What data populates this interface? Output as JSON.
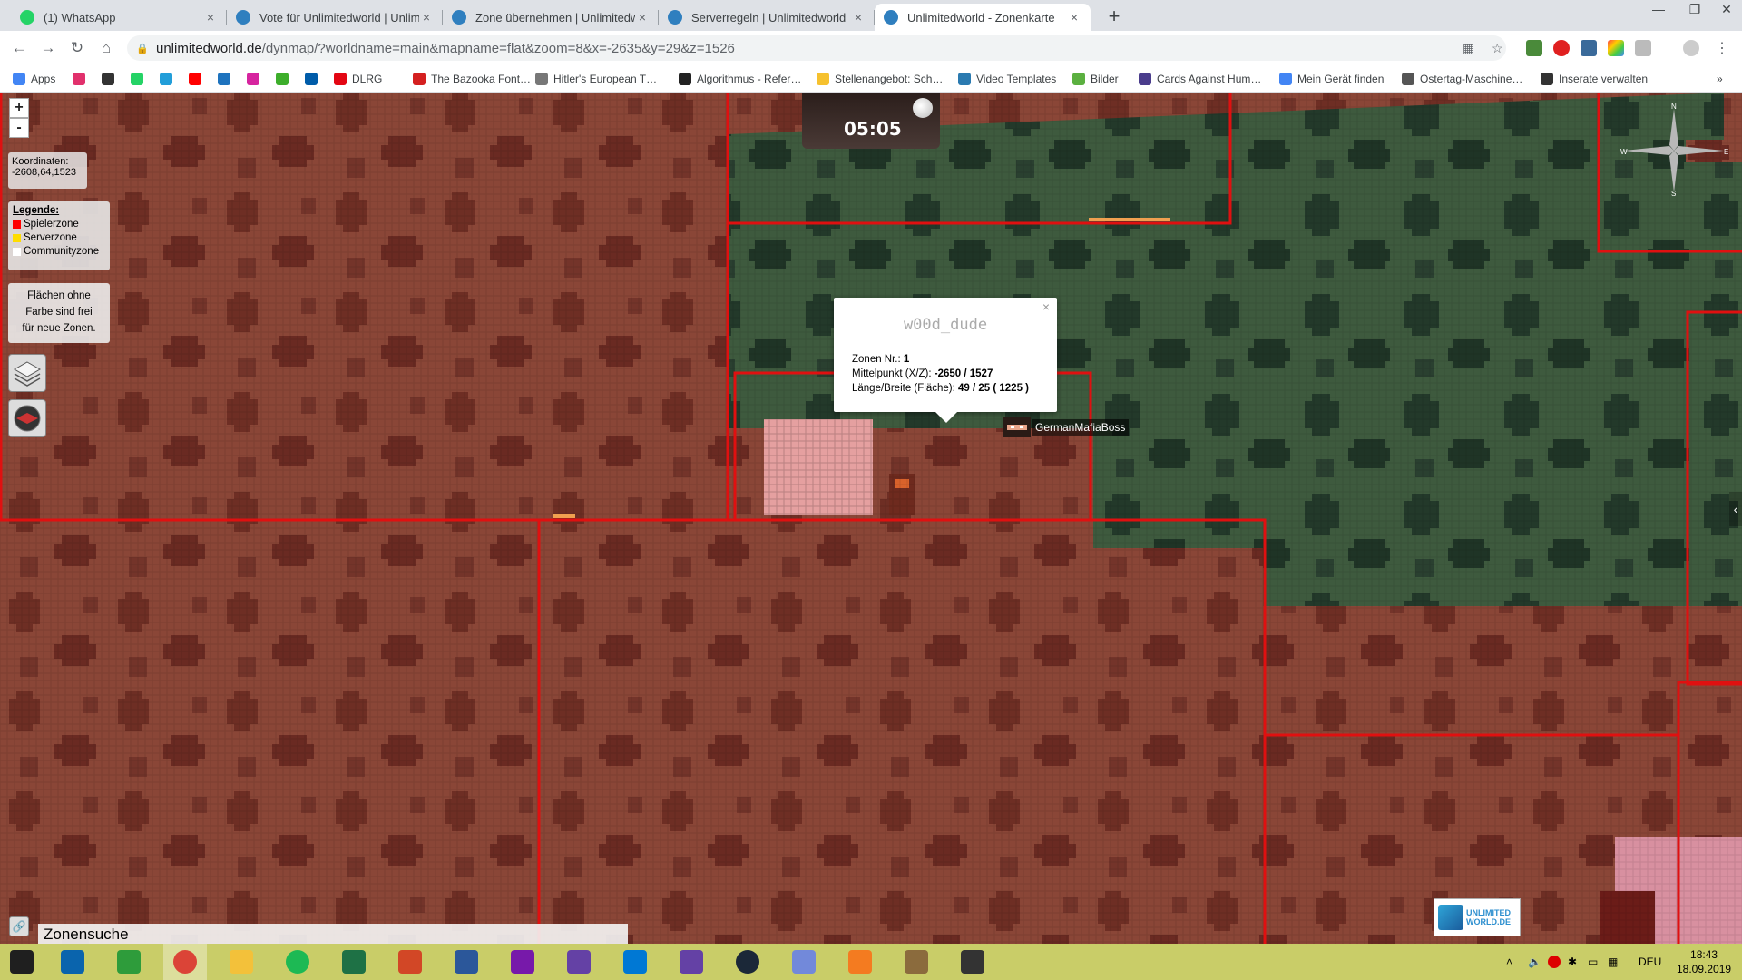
{
  "tabs": [
    {
      "title": "(1) WhatsApp",
      "favicon_color": "#25d366",
      "active": false
    },
    {
      "title": "Vote für Unlimitedworld | Unlim…",
      "favicon_color": "#2f7fbf",
      "active": false
    },
    {
      "title": "Zone übernehmen | Unlimitedwo…",
      "favicon_color": "#2f7fbf",
      "active": false
    },
    {
      "title": "Serverregeln | Unlimitedworld",
      "favicon_color": "#2f7fbf",
      "active": false
    },
    {
      "title": "Unlimitedworld - Zonenkarte",
      "favicon_color": "#2f7fbf",
      "active": true
    }
  ],
  "close_glyph": "×",
  "new_tab_glyph": "+",
  "url": {
    "host": "unlimitedworld.de",
    "path": "/dynmap/?worldname=main&mapname=flat&zoom=8&x=-2635&y=29&z=1526"
  },
  "bookmarks": [
    {
      "label": "Apps",
      "color": "#4285f4"
    },
    {
      "label": "",
      "color": "#e1306c"
    },
    {
      "label": "",
      "color": "#333333"
    },
    {
      "label": "",
      "color": "#25d366"
    },
    {
      "label": "",
      "color": "#229ed9"
    },
    {
      "label": "",
      "color": "#ff0000"
    },
    {
      "label": "",
      "color": "#1e73be"
    },
    {
      "label": "",
      "color": "#d6249f"
    },
    {
      "label": "",
      "color": "#3dae2b"
    },
    {
      "label": "",
      "color": "#005ca9"
    },
    {
      "label": "DLRG",
      "color": "#e30613"
    },
    {
      "label": "The Bazooka Font…",
      "color": "#d42020"
    },
    {
      "label": "Hitler's European T…",
      "color": "#777777"
    },
    {
      "label": "Algorithmus - Refer…",
      "color": "#222222"
    },
    {
      "label": "Stellenangebot: Sch…",
      "color": "#f6c12e"
    },
    {
      "label": "Video Templates",
      "color": "#2a7ab0"
    },
    {
      "label": "Bilder",
      "color": "#5bb040"
    },
    {
      "label": "Cards Against Hum…",
      "color": "#4a3c8c"
    },
    {
      "label": "Mein Gerät finden",
      "color": "#4285f4"
    },
    {
      "label": "Ostertag-Maschine…",
      "color": "#555555"
    },
    {
      "label": "Inserate verwalten",
      "color": "#333333"
    }
  ],
  "bookmarks_more": "»",
  "map": {
    "zoom_in": "+",
    "zoom_out": "-",
    "coords_label": "Koordinaten:",
    "coords_value": "-2608,64,1523",
    "legend_title": "Legende:",
    "legend_items": [
      {
        "label": "Spielerzone",
        "color": "#ff0000"
      },
      {
        "label": "Serverzone",
        "color": "#ffdd00"
      },
      {
        "label": "Communityzone",
        "color": "#ffffff"
      }
    ],
    "free_note_lines": [
      "Flächen ohne",
      "Farbe sind frei",
      "für neue Zonen."
    ],
    "clock_time": "05:05",
    "compass": {
      "n": "N",
      "e": "E",
      "s": "S",
      "w": "W"
    },
    "popup": {
      "title": "w00d_dude",
      "zone_label": "Zonen Nr.:",
      "zone_value": "1",
      "center_label": "Mittelpunkt (X/Z):",
      "center_value": "-2650 / 1527",
      "size_label": "Länge/Breite (Fläche):",
      "size_value": "49 / 25 ( 1225 )"
    },
    "player_name": "GermanMafiaBoss",
    "logo_text_1": "UNLIMITED",
    "logo_text_2": "WORLD.DE",
    "zone_search_label": "Zonensuche",
    "side_toggle": "‹"
  },
  "taskbar": {
    "apps": [
      {
        "name": "start",
        "color": "#1f1f1f"
      },
      {
        "name": "mail",
        "color": "#0a64ad"
      },
      {
        "name": "store",
        "color": "#2e9c3b"
      },
      {
        "name": "chrome",
        "color": "#db4437"
      },
      {
        "name": "explorer",
        "color": "#f3c13a"
      },
      {
        "name": "spotify",
        "color": "#1db954"
      },
      {
        "name": "excel",
        "color": "#1e7145"
      },
      {
        "name": "powerpoint",
        "color": "#d24726"
      },
      {
        "name": "word",
        "color": "#2b579a"
      },
      {
        "name": "onenote",
        "color": "#7719aa"
      },
      {
        "name": "twitch",
        "color": "#6441a5"
      },
      {
        "name": "outlook",
        "color": "#0078d4"
      },
      {
        "name": "twitch-2",
        "color": "#6441a5"
      },
      {
        "name": "steam",
        "color": "#1b2838"
      },
      {
        "name": "discord",
        "color": "#7289da"
      },
      {
        "name": "media-player",
        "color": "#f47b20"
      },
      {
        "name": "minecraft",
        "color": "#8b6b3d"
      },
      {
        "name": "launcher",
        "color": "#333333"
      }
    ],
    "tray_lang": "DEU",
    "time": "18:43",
    "date": "18.09.2019"
  }
}
